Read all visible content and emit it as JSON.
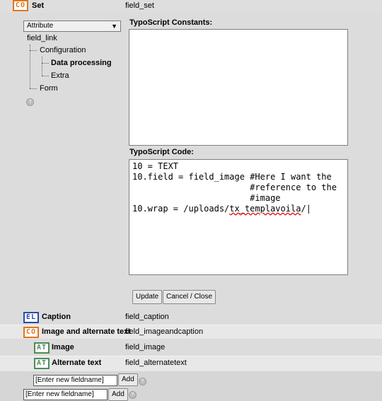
{
  "set": {
    "tag": "CO",
    "title": "Set",
    "field": "field_set"
  },
  "select": {
    "value": "Attribute",
    "arrow": "▼"
  },
  "tree": {
    "root": "field_link",
    "items": [
      {
        "label": "Configuration"
      },
      {
        "label": "Data processing"
      },
      {
        "label": "Extra"
      },
      {
        "label": "Form"
      }
    ]
  },
  "constants": {
    "label": "TypoScript Constants:",
    "value": ""
  },
  "code": {
    "label": "TypoScript Code:",
    "lines": [
      "10 = TEXT",
      "10.field = field_image #Here I want the",
      "                       #reference to the",
      "                       #image",
      "10.wrap = /uploads/"
    ],
    "misspelled": "tx_templavoila",
    "trail": "/|"
  },
  "buttons": {
    "update": "Update",
    "cancel": "Cancel / Close"
  },
  "rows": [
    {
      "tag": "EL",
      "title": "Caption",
      "field": "field_caption"
    },
    {
      "tag": "CO",
      "title": "Image and alternate text",
      "field": "field_imageandcaption"
    },
    {
      "tag": "AT",
      "title": "Image",
      "field": "field_image"
    },
    {
      "tag": "AT",
      "title": "Alternate text",
      "field": "field_alternatetext"
    }
  ],
  "new_field": {
    "placeholder": "[Enter new fieldname]",
    "add": "Add"
  },
  "help_icon": "help-icon",
  "colors": {
    "co": "#e0771b",
    "el": "#2c4aa8",
    "at": "#4e8b5a"
  }
}
